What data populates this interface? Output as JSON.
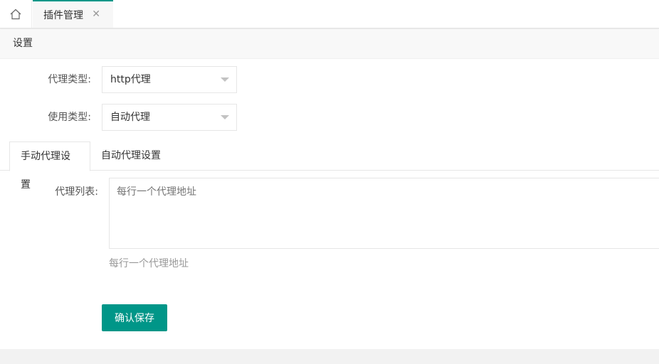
{
  "tabbar": {
    "home_icon": "home-icon",
    "active_tab": {
      "label": "插件管理",
      "close_glyph": "✕"
    }
  },
  "card": {
    "header": "设置",
    "proxy_type": {
      "label": "代理类型:",
      "value": "http代理"
    },
    "use_type": {
      "label": "使用类型:",
      "value": "自动代理"
    },
    "tabs": [
      {
        "label": "手动代理设置",
        "active": true
      },
      {
        "label": "自动代理设置",
        "active": false
      }
    ],
    "proxy_list": {
      "label": "代理列表:",
      "placeholder": "每行一个代理地址",
      "hint": "每行一个代理地址"
    },
    "save_label": "确认保存"
  },
  "colors": {
    "accent": "#009688"
  }
}
